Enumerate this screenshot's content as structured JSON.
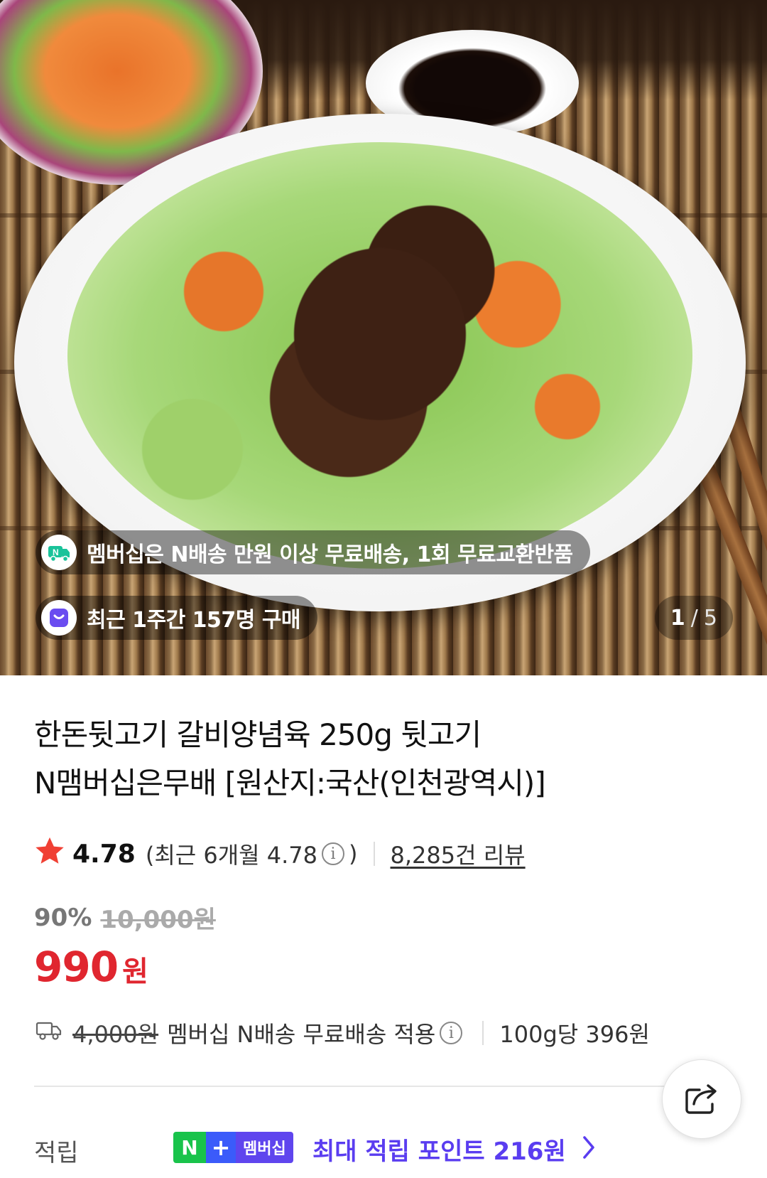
{
  "hero": {
    "membership_notice": "멤버십은 N배송 만원 이상 무료배송, 1회 무료교환반품",
    "recent_purchases": "최근 1주간 157명 구매",
    "image_counter": {
      "current": "1",
      "separator": "/",
      "total": "5"
    }
  },
  "product": {
    "title_line1": "한돈뒷고기 갈비양념육 250g 뒷고기",
    "title_line2": "N맴버십은무배 [원산지:국산(인천광역시)]"
  },
  "rating": {
    "score": "4.78",
    "recent_prefix": "(최근 6개월 4.78",
    "info_glyph": "i",
    "recent_suffix": ")",
    "review_count": "8,285건 리뷰"
  },
  "price": {
    "discount": "90%",
    "original": "10,000원",
    "sale": "990",
    "currency": "원"
  },
  "shipping": {
    "fee": "4,000원",
    "note": "멤버십 N배송 무료배송 적용",
    "info_glyph": "i",
    "unit_price": "100g당 396원"
  },
  "points": {
    "label": "적립",
    "badge_n": "N",
    "badge_plus": "+",
    "badge_membership": "멤버십",
    "text": "최대 적립 포인트 216원"
  },
  "colors": {
    "price_red": "#e0262f",
    "points_purple": "#5a3df0",
    "badge_green": "#19c34b",
    "badge_blue": "#3b5bfa",
    "star_red": "#f04034"
  },
  "icons": [
    "delivery-badge-icon",
    "purchase-bag-icon",
    "star-icon",
    "info-icon",
    "truck-icon",
    "share-icon",
    "chevron-right-icon"
  ]
}
